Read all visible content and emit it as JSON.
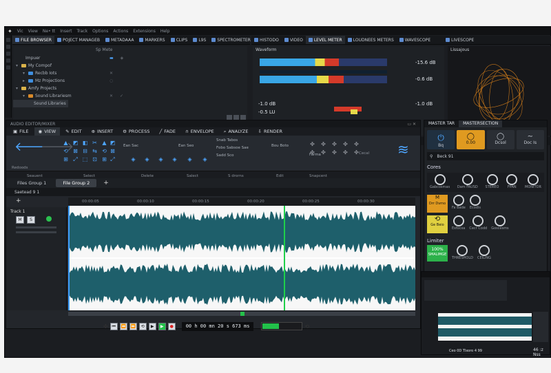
{
  "menu": [
    "Vic",
    "View",
    "Ne• tt",
    "Insert",
    "Track",
    "Options",
    "Actions",
    "Extensions",
    "Help"
  ],
  "top_tabs_left": [
    {
      "label": "FILE BROWSER",
      "icon": "folder-icon"
    },
    {
      "label": "POJECT MANAGEB",
      "icon": "project-icon"
    },
    {
      "label": "METADAAA",
      "icon": "metadata-icon"
    },
    {
      "label": "MARKERS",
      "icon": "marker-icon"
    },
    {
      "label": "CLIPS",
      "icon": "clip-icon"
    },
    {
      "label": "L9S",
      "icon": "list-icon"
    },
    {
      "label": "SPECTROMETER",
      "icon": "spectrum-icon"
    }
  ],
  "top_tabs_right": [
    {
      "label": "HISTODO",
      "icon": "history-icon"
    },
    {
      "label": "VIDEO",
      "icon": "video-icon"
    },
    {
      "label": "LEVEL METER",
      "icon": "meter-icon"
    },
    {
      "label": "LOUDNEES METERS",
      "icon": "loudness-icon"
    },
    {
      "label": "WAVESCOPE",
      "icon": "scope-icon"
    },
    {
      "label": "LIVESCOPE",
      "icon": "scope-icon"
    }
  ],
  "browser": {
    "sub_label": "Sp Mete",
    "tree": [
      {
        "label": "Impuer",
        "indent": 2,
        "folder": false
      },
      {
        "label": "My Compof",
        "indent": 1,
        "folder": true
      },
      {
        "label": "Recbb Iots",
        "indent": 2,
        "folder": true
      },
      {
        "label": "Mz Projections",
        "indent": 2,
        "folder": true
      },
      {
        "label": "Amfy Projects",
        "indent": 1,
        "folder": true
      },
      {
        "label": "Sound Librariesm",
        "indent": 2,
        "folder": true
      },
      {
        "label": "Sound Libraries",
        "indent": 3,
        "folder": false
      }
    ]
  },
  "level_meter": {
    "title": "Waveform",
    "db_l": "-15.6 dB",
    "db_r": "-0.6 dB",
    "lufs1": "-1.0 dB",
    "lufs2": "-0.5 LU",
    "lufs3": "-1.0 dB",
    "fill_l": 0.62,
    "fill_r": 0.66
  },
  "lissajous_title": "Lissajous",
  "editor": {
    "title": "AUDIO EDITOR/MIXER",
    "ribbon_tabs": [
      {
        "label": "FILE",
        "icon": "file-icon"
      },
      {
        "label": "VIEW",
        "icon": "eye-icon"
      },
      {
        "label": "EDIT",
        "icon": "edit-icon"
      },
      {
        "label": "INSERT",
        "icon": "insert-icon"
      },
      {
        "label": "PROCESS",
        "icon": "process-icon"
      },
      {
        "label": "FADE",
        "icon": "fade-icon"
      },
      {
        "label": "ENVELOPE",
        "icon": "envelope-icon"
      },
      {
        "label": "ANALYZE",
        "icon": "analyze-icon"
      },
      {
        "label": "RENDER",
        "icon": "render-icon"
      }
    ],
    "ribbon_groups": [
      "Redoods",
      "Seauent",
      "Select",
      "Delete",
      "Salect",
      "S drorns",
      "Edit",
      "Snapcent",
      "Cecal"
    ],
    "ribbon_texts": [
      "Ean Sac",
      "Ean Seo",
      "Snab Tabos",
      "Fobo Sabsoe Sae",
      "Sadd Sco",
      "Bou Boto",
      "Farma"
    ],
    "group_tabs": [
      "Files Group 1",
      "File Group 2"
    ],
    "file_header": "Saetead 9 1",
    "track_name": "Track 1",
    "ruler": [
      "00:00:05",
      "00:00:10",
      "00:00:15",
      "00:00:20",
      "00:00:25",
      "00:00:30"
    ],
    "timecode": "00 h 00 mn 20 s 673 ms"
  },
  "master": {
    "tabs": [
      "MASTER TAR",
      "MASTERSECTION"
    ],
    "top_vals": [
      "Bq",
      "0.00",
      "Dcsol",
      "Doc Is"
    ],
    "bank": "Beck 91",
    "cores_title": "Cores",
    "cores_labels": [
      "Gabcosmas",
      "Dam FAUSD",
      "STEREO",
      "FPAN",
      "MONITOR"
    ],
    "row2": [
      "Drr Dvmo",
      "Fa Bade",
      "Ecodis"
    ],
    "row3": [
      "Ge Beio",
      "Esfocxa",
      "Cecr Codd",
      "Goscesms"
    ],
    "limiter_title": "Limiter",
    "limiter": {
      "value": "100%",
      "labels": [
        "SMALIMGE",
        "THRESHOLD",
        "CEILING"
      ]
    }
  },
  "mini_status": "46 :z Nss",
  "mini_time": "Ceo 0D TIxoro 4 99"
}
